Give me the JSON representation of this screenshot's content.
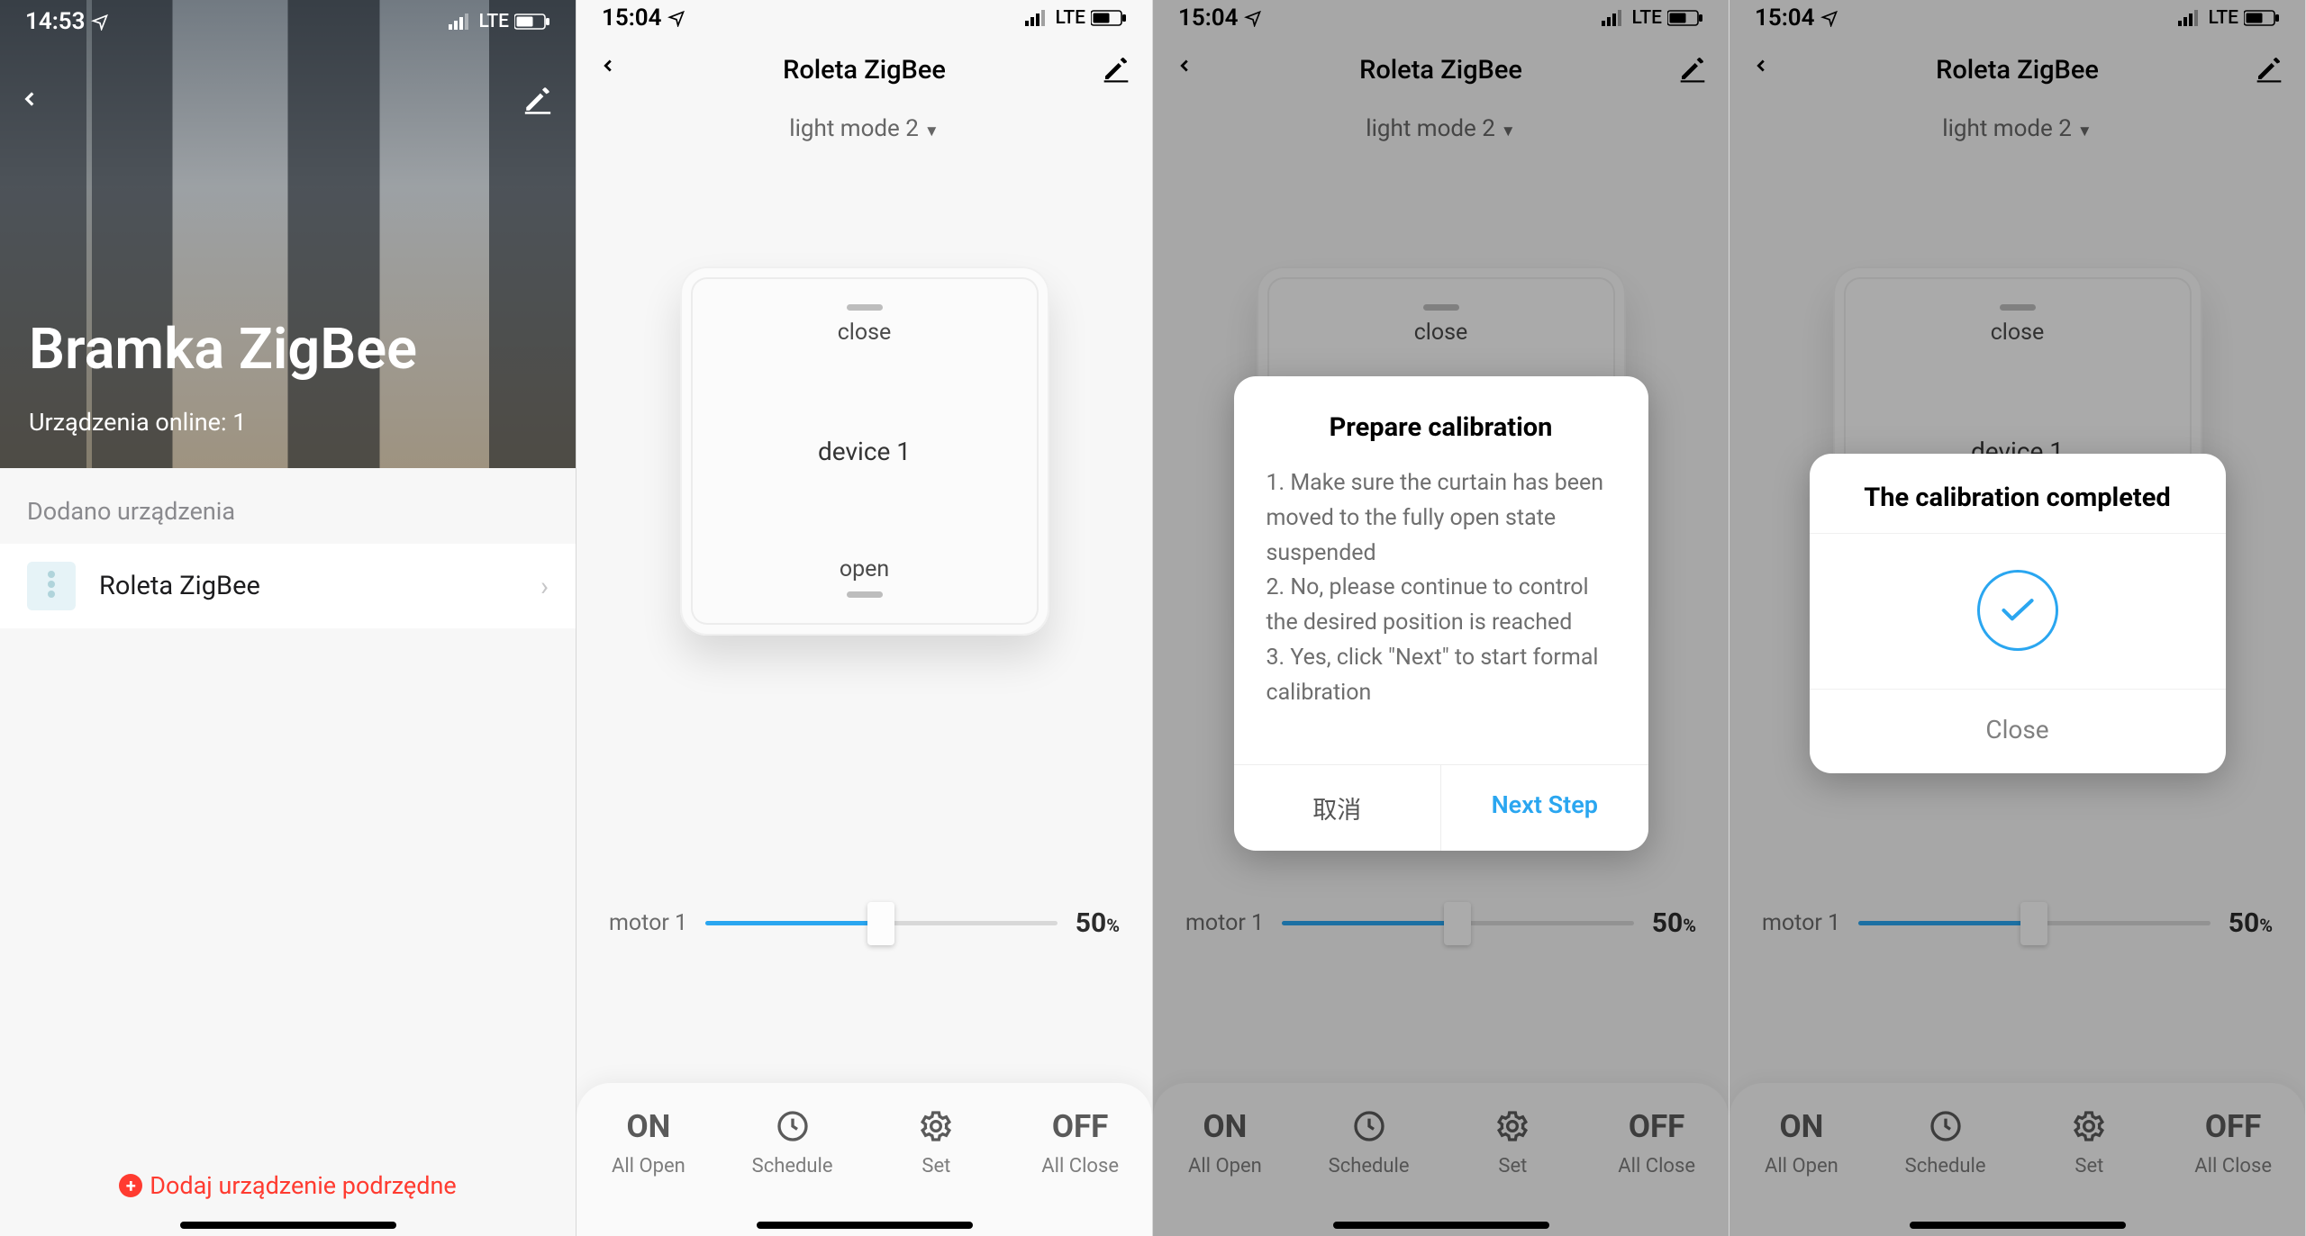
{
  "status": {
    "time_s1": "14:53",
    "time_s2": "15:04",
    "net": "LTE"
  },
  "screen1": {
    "hero_title": "Bramka ZigBee",
    "hero_sub_prefix": "Urządzenia online: ",
    "online_count": "1",
    "section_added": "Dodano urządzenia",
    "device_name": "Roleta ZigBee",
    "add_sub": "Dodaj urządzenie podrzędne"
  },
  "device": {
    "title": "Roleta ZigBee",
    "mode": "light mode 2",
    "close": "close",
    "open": "open",
    "device_label": "device 1",
    "motor_label": "motor 1",
    "slider_value": "50",
    "percent": "%"
  },
  "bottombar": {
    "on": "ON",
    "off": "OFF",
    "all_open": "All Open",
    "schedule": "Schedule",
    "set": "Set",
    "all_close": "All Close"
  },
  "modal_prepare": {
    "title": "Prepare calibration",
    "line1": "1. Make sure the curtain has been moved to the fully open state suspended",
    "line2": "2. No, please continue to control the desired position is reached",
    "line3": "3. Yes, click \"Next\" to start formal calibration",
    "cancel": "取消",
    "next": "Next Step"
  },
  "modal_done": {
    "title": "The calibration completed",
    "close": "Close"
  }
}
